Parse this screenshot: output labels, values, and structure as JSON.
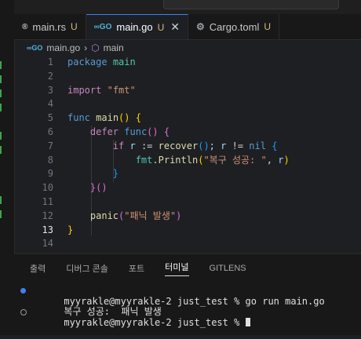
{
  "tabs": [
    {
      "icon": "rust-icon",
      "label": "main.rs",
      "status": "U",
      "active": false
    },
    {
      "icon": "go-icon",
      "label": "main.go",
      "status": "U",
      "active": true
    },
    {
      "icon": "gear-icon",
      "label": "Cargo.toml",
      "status": "U",
      "active": false
    }
  ],
  "breadcrumb": {
    "file": "main.go",
    "symbol": "main"
  },
  "editor": {
    "current_line": 13,
    "line_numbers": [
      "1",
      "2",
      "3",
      "4",
      "5",
      "6",
      "7",
      "8",
      "9",
      "10",
      "11",
      "12",
      "13",
      "14"
    ],
    "lines": {
      "l1": {
        "kw": "package",
        "name": "main"
      },
      "l3": {
        "kw": "import",
        "str": "\"fmt\""
      },
      "l5": {
        "kw": "func",
        "name": "main",
        "parens": "()",
        "brace": "{"
      },
      "l6": {
        "kw": "defer",
        "name": "func",
        "parens": "()",
        "brace": "{"
      },
      "l7": {
        "kw": "if",
        "var1": "r",
        "op1": ":=",
        "call": "recover",
        "parens": "()",
        "semi": ";",
        "var2": "r",
        "op2": "!=",
        "nil": "nil",
        "brace": "{"
      },
      "l8": {
        "pkg": "fmt",
        "dot": ".",
        "call": "Println",
        "open": "(",
        "str": "\"복구 성공: \"",
        "comma": ",",
        "arg": "r",
        "close": ")"
      },
      "l9": {
        "brace": "}"
      },
      "l10": {
        "brace": "}",
        "parens": "()"
      },
      "l12": {
        "call": "panic",
        "open": "(",
        "str": "\"패닉 발생\"",
        "close": ")"
      },
      "l13": {
        "brace": "}"
      }
    }
  },
  "panel": {
    "tabs": [
      "출력",
      "디버그 콘솔",
      "포트",
      "터미널",
      "GITLENS"
    ],
    "active_tab": "터미널"
  },
  "terminal": {
    "lines": [
      "myyrakle@myyrakle-2 just_test % go run main.go",
      "복구 성공:  패닉 발생",
      "myyrakle@myyrakle-2 just_test % "
    ]
  },
  "colors": {
    "accent": "#3b82f6",
    "modified": "#d7ba7d",
    "background": "#1e1f22"
  }
}
